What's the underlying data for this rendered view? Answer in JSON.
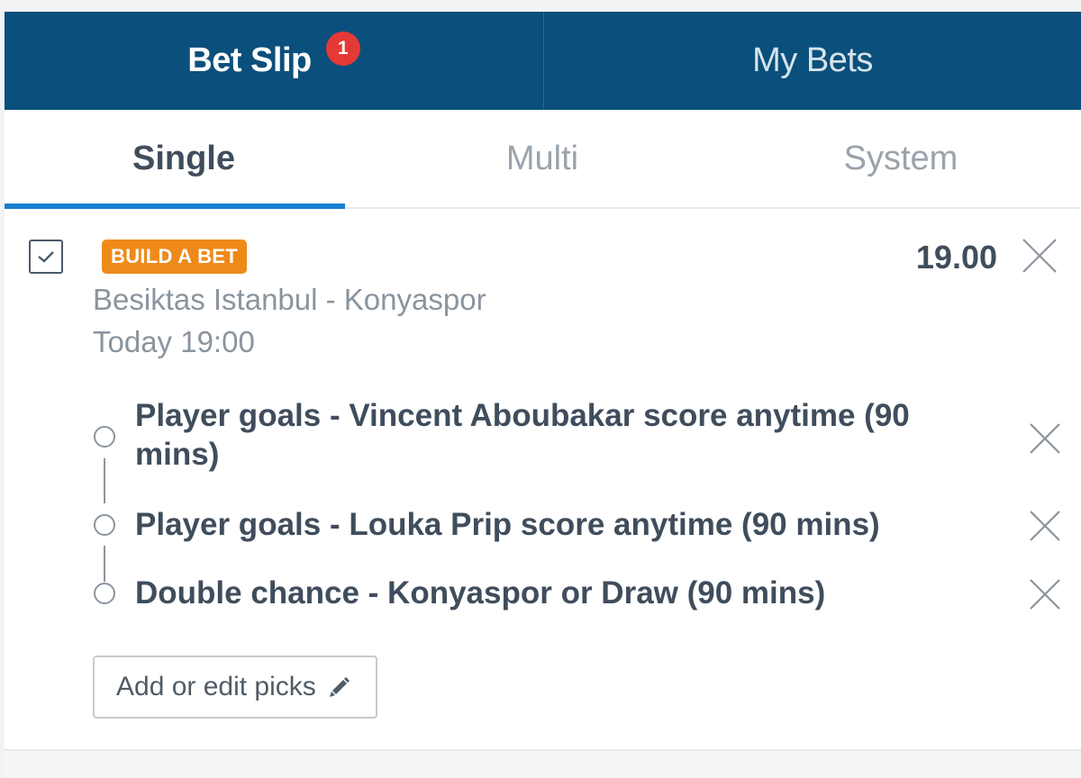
{
  "header_tabs": {
    "bet_slip": "Bet Slip",
    "bet_slip_count": "1",
    "my_bets": "My Bets"
  },
  "bet_types": [
    "Single",
    "Multi",
    "System"
  ],
  "bet": {
    "badge": "BUILD A BET",
    "odds": "19.00",
    "match": "Besiktas Istanbul - Konyaspor",
    "time": "Today 19:00",
    "picks": [
      "Player goals - Vincent Aboubakar score anytime (90 mins)",
      "Player goals - Louka Prip score anytime (90 mins)",
      "Double chance - Konyaspor or Draw (90 mins)"
    ],
    "edit_label": "Add or edit picks"
  },
  "colors": {
    "header_bg": "#0b4f7c",
    "accent": "#1a7fd1",
    "badge_orange": "#ee8a1a",
    "count_red": "#e53935"
  }
}
